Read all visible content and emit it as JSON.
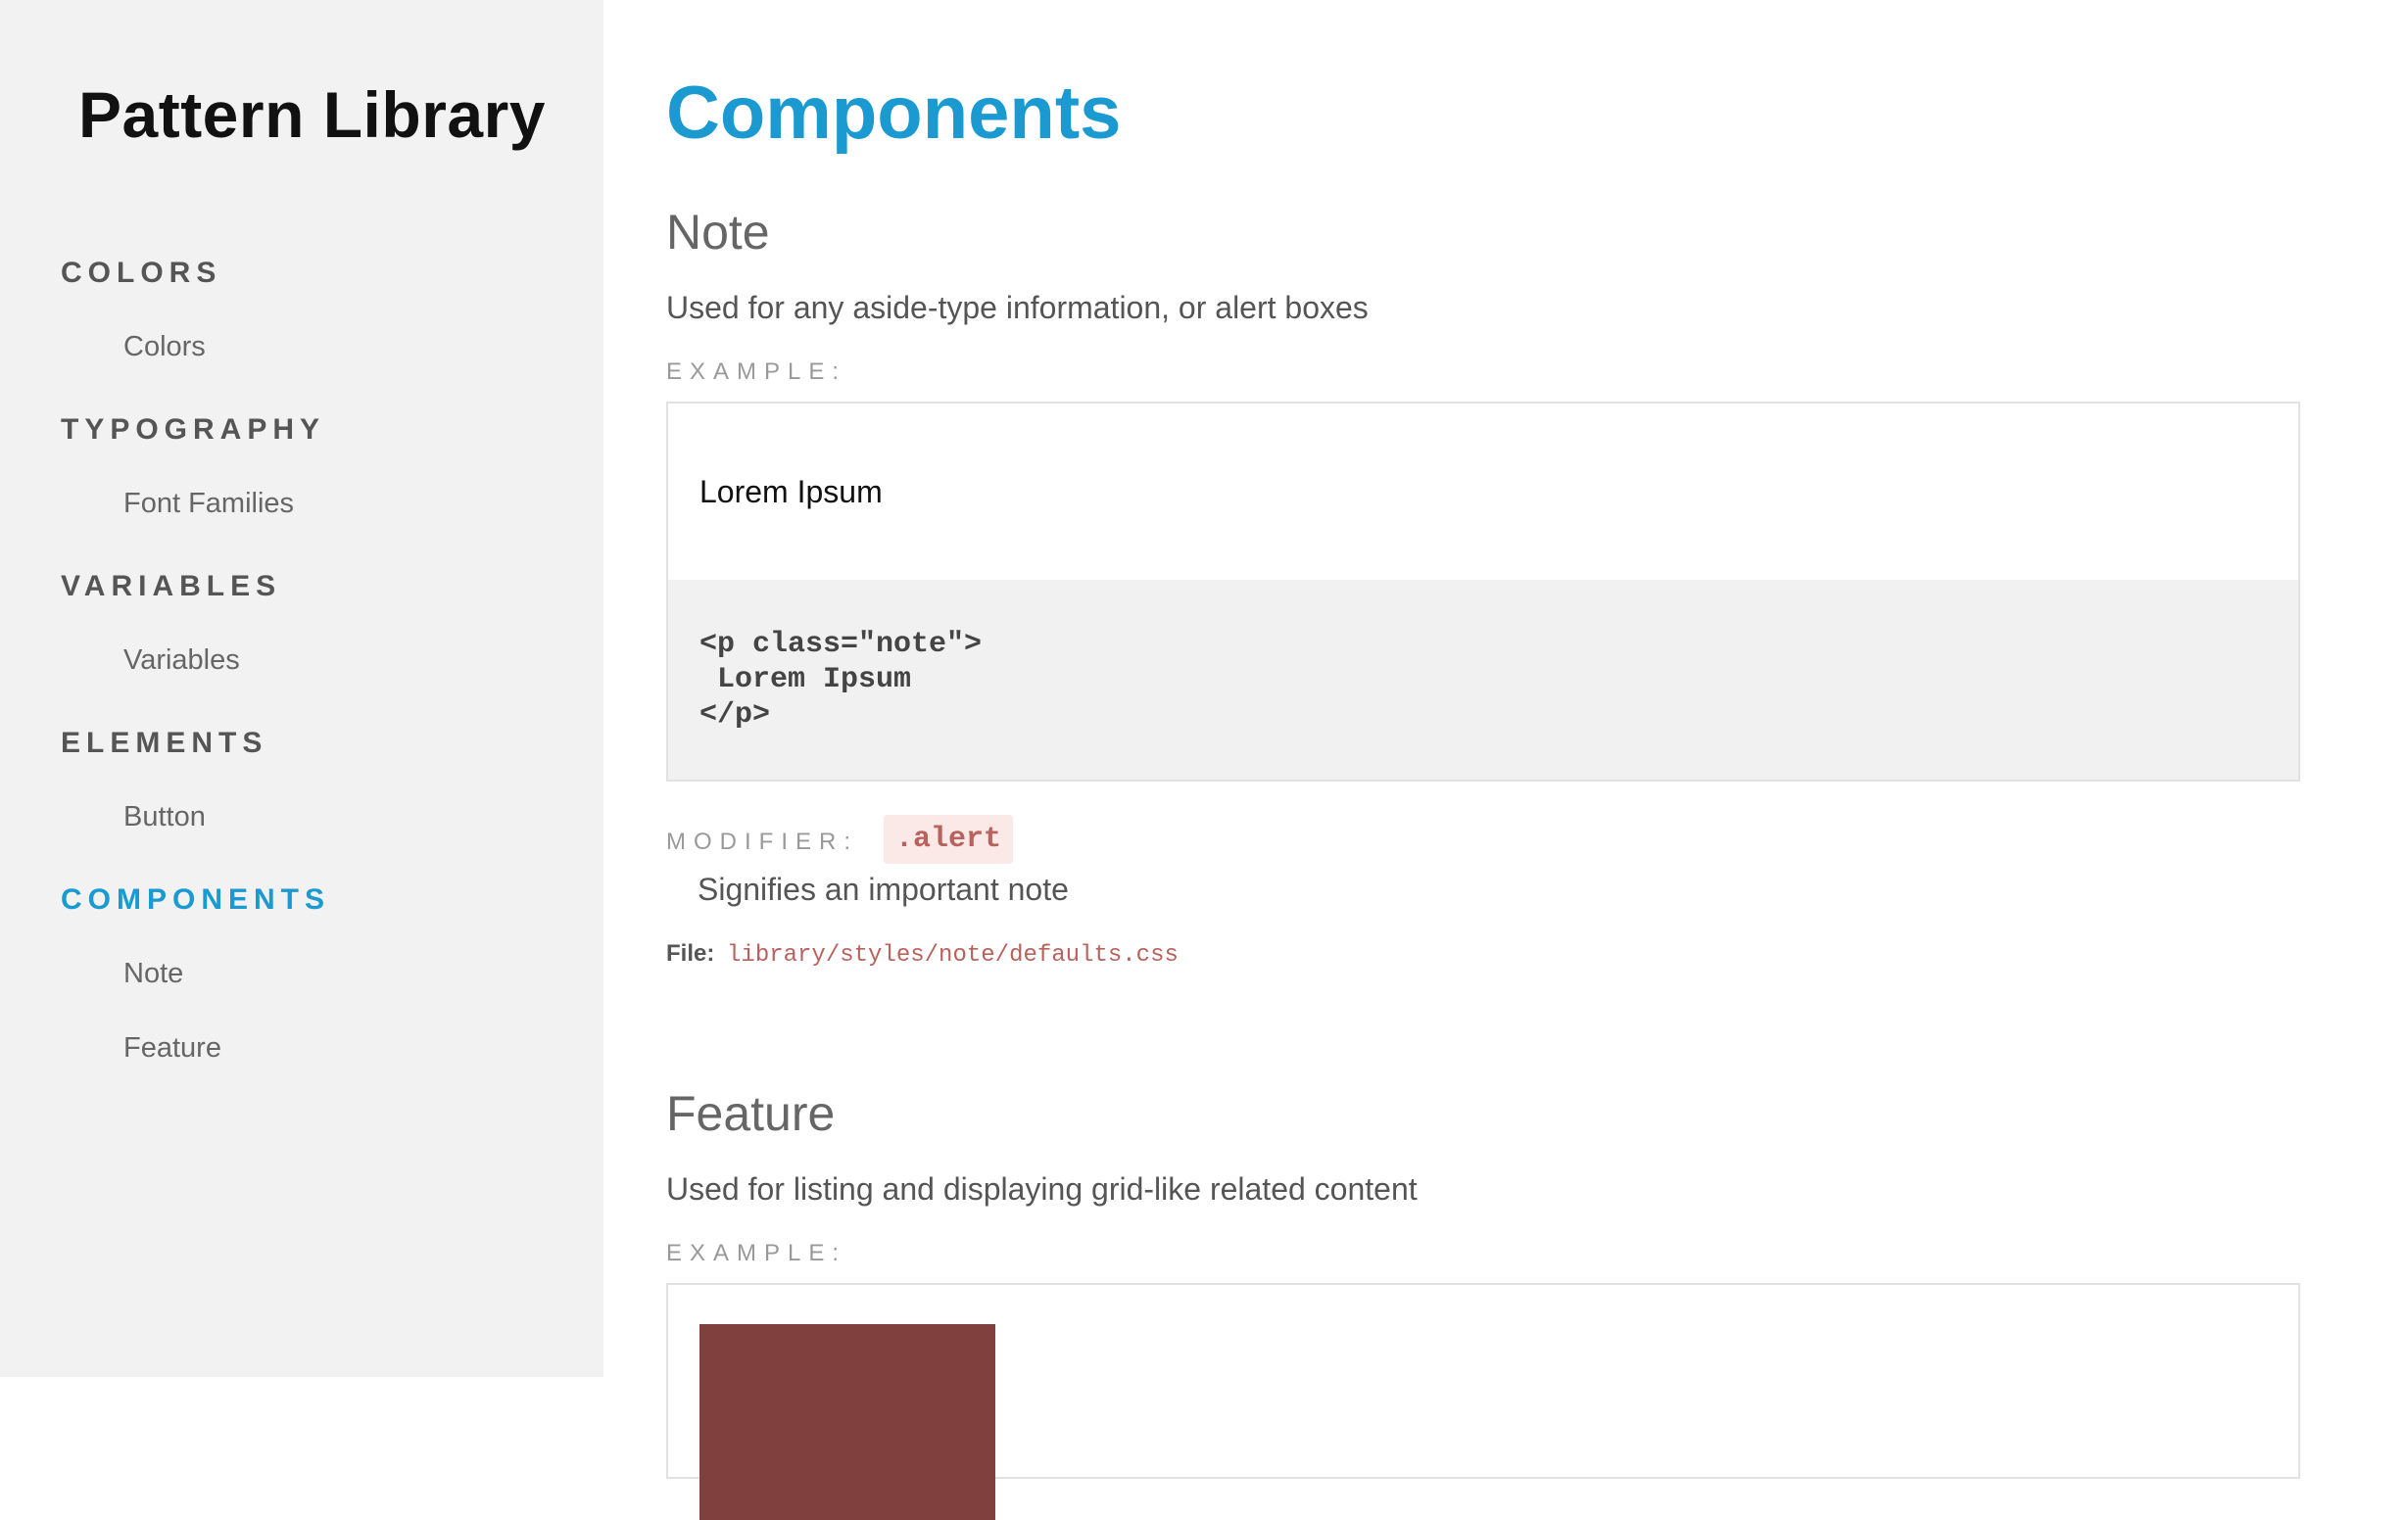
{
  "sidebar": {
    "title": "Pattern Library",
    "groups": [
      {
        "title": "COLORS",
        "items": [
          "Colors"
        ]
      },
      {
        "title": "TYPOGRAPHY",
        "items": [
          "Font Families"
        ]
      },
      {
        "title": "VARIABLES",
        "items": [
          "Variables"
        ]
      },
      {
        "title": "ELEMENTS",
        "items": [
          "Button"
        ]
      },
      {
        "title": "COMPONENTS",
        "items": [
          "Note",
          "Feature"
        ],
        "active": true
      }
    ],
    "active_color": "#1a9ad0"
  },
  "main": {
    "page_title": "Components",
    "sections": [
      {
        "title": "Note",
        "description": "Used for any aside-type information, or alert boxes",
        "example_label": "EXAMPLE:",
        "example_text": "Lorem Ipsum",
        "example_code": "<p class=\"note\">\n Lorem Ipsum\n</p>",
        "modifier_label": "MODIFIER:",
        "modifier_class": ".alert",
        "modifier_description": "Signifies an important note",
        "file_label": "File:",
        "file_path": "library/styles/note/defaults.css"
      },
      {
        "title": "Feature",
        "description": "Used for listing and displaying grid-like related content",
        "example_label": "EXAMPLE:",
        "swatch_color": "#7f403e"
      }
    ]
  }
}
